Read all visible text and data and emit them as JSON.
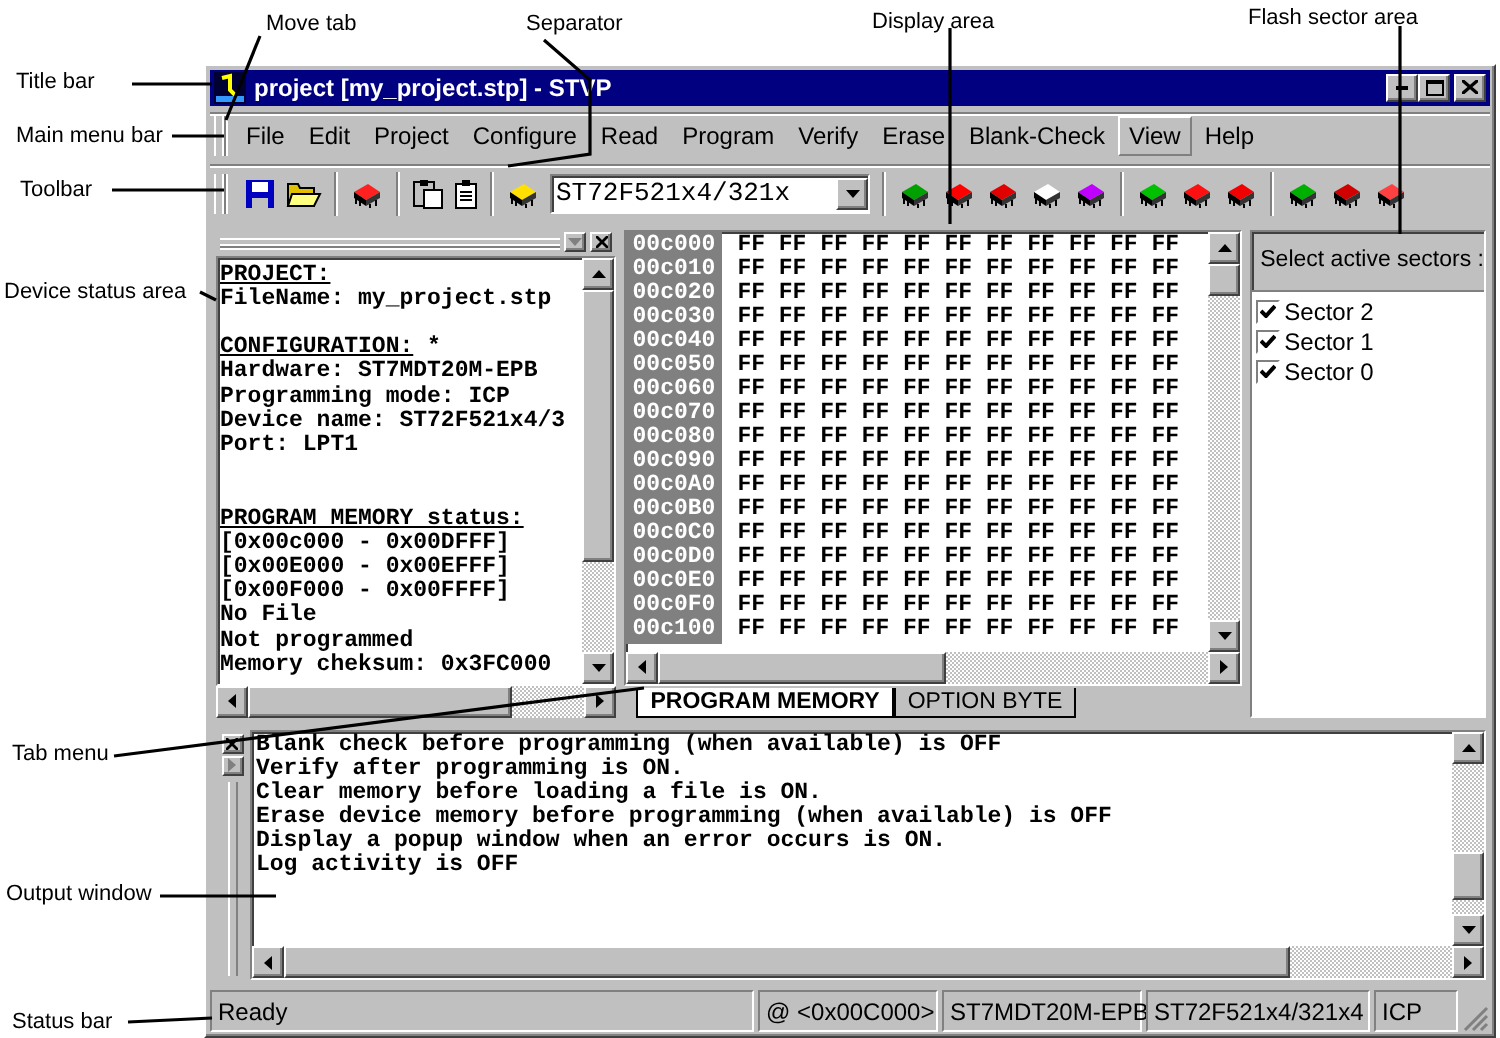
{
  "window": {
    "title": "project [my_project.stp] - STVP"
  },
  "menu": [
    {
      "label": "File",
      "selected": false
    },
    {
      "label": "Edit",
      "selected": false
    },
    {
      "label": "Project",
      "selected": false
    },
    {
      "label": "Configure",
      "selected": false
    },
    {
      "label": "Read",
      "selected": false
    },
    {
      "label": "Program",
      "selected": false
    },
    {
      "label": "Verify",
      "selected": false
    },
    {
      "label": "Erase",
      "selected": false
    },
    {
      "label": "Blank-Check",
      "selected": false
    },
    {
      "label": "View",
      "selected": true
    },
    {
      "label": "Help",
      "selected": false
    }
  ],
  "toolbar": {
    "device": "ST72F521x4/321x"
  },
  "device_status": {
    "lines": [
      {
        "kind": "heading",
        "text": "PROJECT:"
      },
      {
        "kind": "text",
        "text": "FileName: my_project.stp"
      },
      {
        "kind": "gap"
      },
      {
        "kind": "heading",
        "text": "CONFIGURATION:",
        "note": "*"
      },
      {
        "kind": "text",
        "text": "Hardware: ST7MDT20M-EPB"
      },
      {
        "kind": "text",
        "text": "Programming mode: ICP"
      },
      {
        "kind": "text",
        "text": "Device name: ST72F521x4/3"
      },
      {
        "kind": "text",
        "text": "Port: LPT1"
      },
      {
        "kind": "gap"
      },
      {
        "kind": "gap"
      },
      {
        "kind": "heading",
        "text": "PROGRAM MEMORY status:"
      },
      {
        "kind": "text",
        "text": "[0x00c000 - 0x00DFFF]"
      },
      {
        "kind": "text",
        "text": "[0x00E000 - 0x00EFFF]"
      },
      {
        "kind": "text",
        "text": "[0x00F000 - 0x00FFFF]"
      },
      {
        "kind": "text",
        "text": "No File"
      },
      {
        "kind": "text",
        "text": "Not programmed"
      },
      {
        "kind": "text",
        "text": "Memory cheksum: 0x3FC000"
      }
    ]
  },
  "memory_view": {
    "rows": [
      {
        "address": "00c000",
        "values": "FF FF FF FF FF FF FF FF FF FF FF"
      },
      {
        "address": "00c010",
        "values": "FF FF FF FF FF FF FF FF FF FF FF"
      },
      {
        "address": "00c020",
        "values": "FF FF FF FF FF FF FF FF FF FF FF"
      },
      {
        "address": "00c030",
        "values": "FF FF FF FF FF FF FF FF FF FF FF"
      },
      {
        "address": "00c040",
        "values": "FF FF FF FF FF FF FF FF FF FF FF"
      },
      {
        "address": "00c050",
        "values": "FF FF FF FF FF FF FF FF FF FF FF"
      },
      {
        "address": "00c060",
        "values": "FF FF FF FF FF FF FF FF FF FF FF"
      },
      {
        "address": "00c070",
        "values": "FF FF FF FF FF FF FF FF FF FF FF"
      },
      {
        "address": "00c080",
        "values": "FF FF FF FF FF FF FF FF FF FF FF"
      },
      {
        "address": "00c090",
        "values": "FF FF FF FF FF FF FF FF FF FF FF"
      },
      {
        "address": "00c0A0",
        "values": "FF FF FF FF FF FF FF FF FF FF FF"
      },
      {
        "address": "00c0B0",
        "values": "FF FF FF FF FF FF FF FF FF FF FF"
      },
      {
        "address": "00c0C0",
        "values": "FF FF FF FF FF FF FF FF FF FF FF"
      },
      {
        "address": "00c0D0",
        "values": "FF FF FF FF FF FF FF FF FF FF FF"
      },
      {
        "address": "00c0E0",
        "values": "FF FF FF FF FF FF FF FF FF FF FF"
      },
      {
        "address": "00c0F0",
        "values": "FF FF FF FF FF FF FF FF FF FF FF"
      },
      {
        "address": "00c100",
        "values": "FF FF FF FF FF FF FF FF FF FF FF"
      }
    ],
    "tabs": [
      {
        "label": "PROGRAM MEMORY",
        "selected": true
      },
      {
        "label": "OPTION BYTE",
        "selected": false
      }
    ]
  },
  "sectors": {
    "header": "Select active sectors :",
    "items": [
      {
        "label": "Sector 2",
        "checked": true
      },
      {
        "label": "Sector 1",
        "checked": true
      },
      {
        "label": "Sector 0",
        "checked": true
      }
    ]
  },
  "output": {
    "lines": [
      "Blank check before programming (when available) is OFF",
      "Verify after programming is ON.",
      "Clear memory before loading a file is ON.",
      "Erase device memory before programming (when available) is OFF",
      "Display a popup window when an error occurs is ON.",
      "Log activity is OFF"
    ]
  },
  "status_bar": [
    "Ready",
    "@ <0x00C000>",
    "ST7MDT20M-EPB",
    "ST72F521x4/321x4",
    "ICP"
  ],
  "callouts": [
    {
      "label": "Title bar"
    },
    {
      "label": "Main menu bar"
    },
    {
      "label": "Toolbar"
    },
    {
      "label": "Device status area"
    },
    {
      "label": "Tab menu"
    },
    {
      "label": "Output window"
    },
    {
      "label": "Status bar"
    },
    {
      "label": "Move tab"
    },
    {
      "label": "Separator"
    },
    {
      "label": "Display area"
    },
    {
      "label": "Flash sector area"
    }
  ]
}
